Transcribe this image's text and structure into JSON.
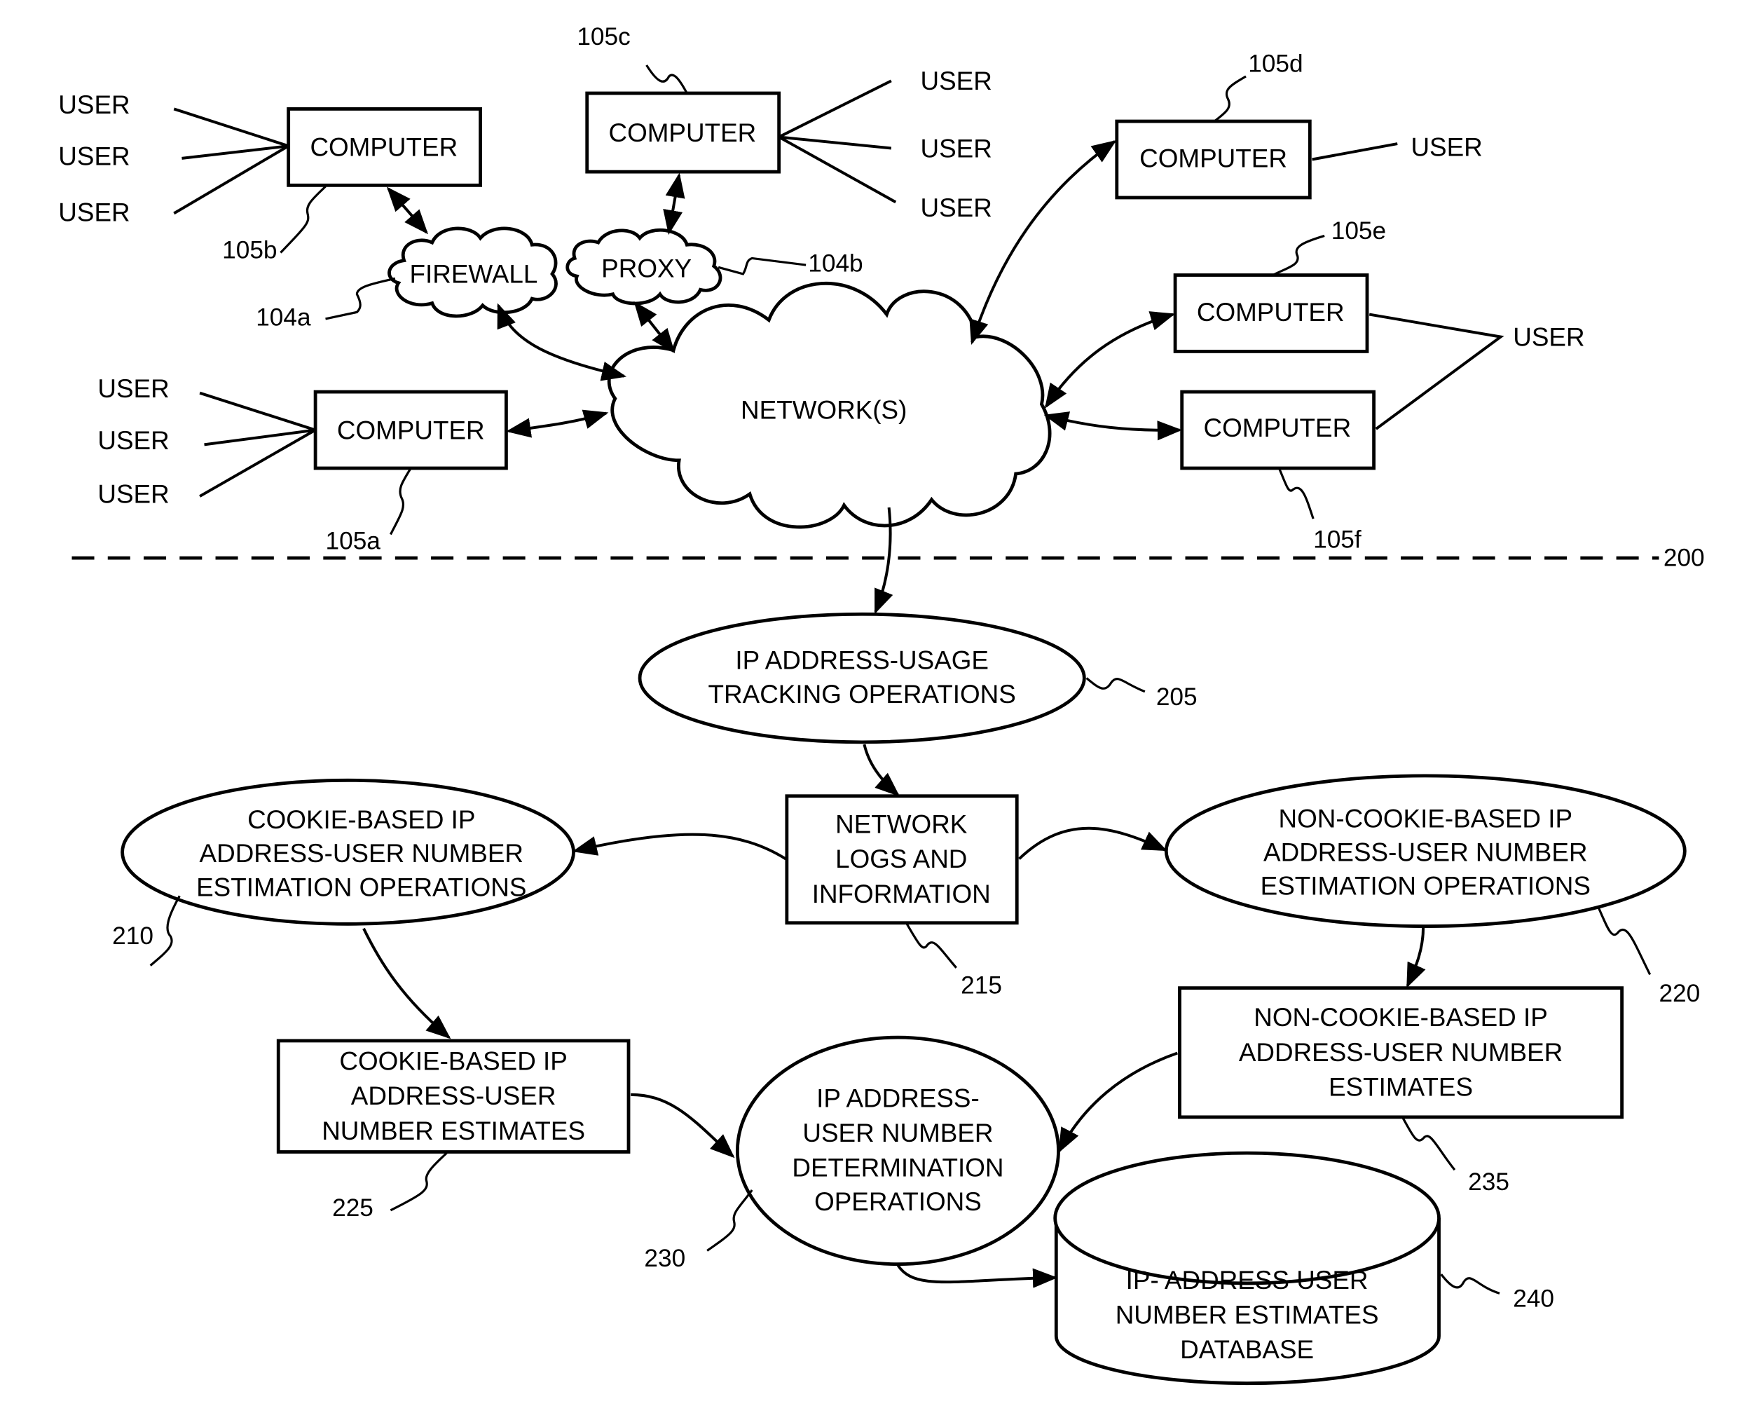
{
  "figure": {
    "divider_ref": "200",
    "network": {
      "label": "NETWORK(S)"
    },
    "firewall": {
      "label": "FIREWALL",
      "ref": "104a"
    },
    "proxy": {
      "label": "PROXY",
      "ref": "104b"
    },
    "computers": [
      {
        "id": "105a",
        "label": "COMPUTER",
        "ref": "105a",
        "users": [
          "USER",
          "USER",
          "USER"
        ]
      },
      {
        "id": "105b",
        "label": "COMPUTER",
        "ref": "105b",
        "users": [
          "USER",
          "USER",
          "USER"
        ]
      },
      {
        "id": "105c",
        "label": "COMPUTER",
        "ref": "105c",
        "users": [
          "USER",
          "USER",
          "USER"
        ]
      },
      {
        "id": "105d",
        "label": "COMPUTER",
        "ref": "105d",
        "users": [
          "USER"
        ]
      },
      {
        "id": "105e",
        "label": "COMPUTER",
        "ref": "105e"
      },
      {
        "id": "105f",
        "label": "COMPUTER",
        "ref": "105f"
      }
    ],
    "shared_user": "USER",
    "nodes": {
      "tracking": {
        "lines": [
          "IP ADDRESS-USAGE",
          "TRACKING OPERATIONS"
        ],
        "ref": "205"
      },
      "cookie_ops": {
        "lines": [
          "COOKIE-BASED IP",
          "ADDRESS-USER NUMBER",
          "ESTIMATION OPERATIONS"
        ],
        "ref": "210"
      },
      "logs": {
        "lines": [
          "NETWORK",
          "LOGS AND",
          "INFORMATION"
        ],
        "ref": "215"
      },
      "noncookie_ops": {
        "lines": [
          "NON-COOKIE-BASED IP",
          "ADDRESS-USER NUMBER",
          "ESTIMATION OPERATIONS"
        ],
        "ref": "220"
      },
      "cookie_est": {
        "lines": [
          "COOKIE-BASED IP",
          "ADDRESS-USER",
          "NUMBER ESTIMATES"
        ],
        "ref": "225"
      },
      "determination": {
        "lines": [
          "IP ADDRESS-",
          "USER NUMBER",
          "DETERMINATION",
          "OPERATIONS"
        ],
        "ref": "230"
      },
      "noncookie_est": {
        "lines": [
          "NON-COOKIE-BASED IP",
          "ADDRESS-USER NUMBER",
          "ESTIMATES"
        ],
        "ref": "235"
      },
      "database": {
        "lines": [
          "IP- ADDRESS USER",
          "NUMBER ESTIMATES",
          "DATABASE"
        ],
        "ref": "240"
      }
    }
  }
}
